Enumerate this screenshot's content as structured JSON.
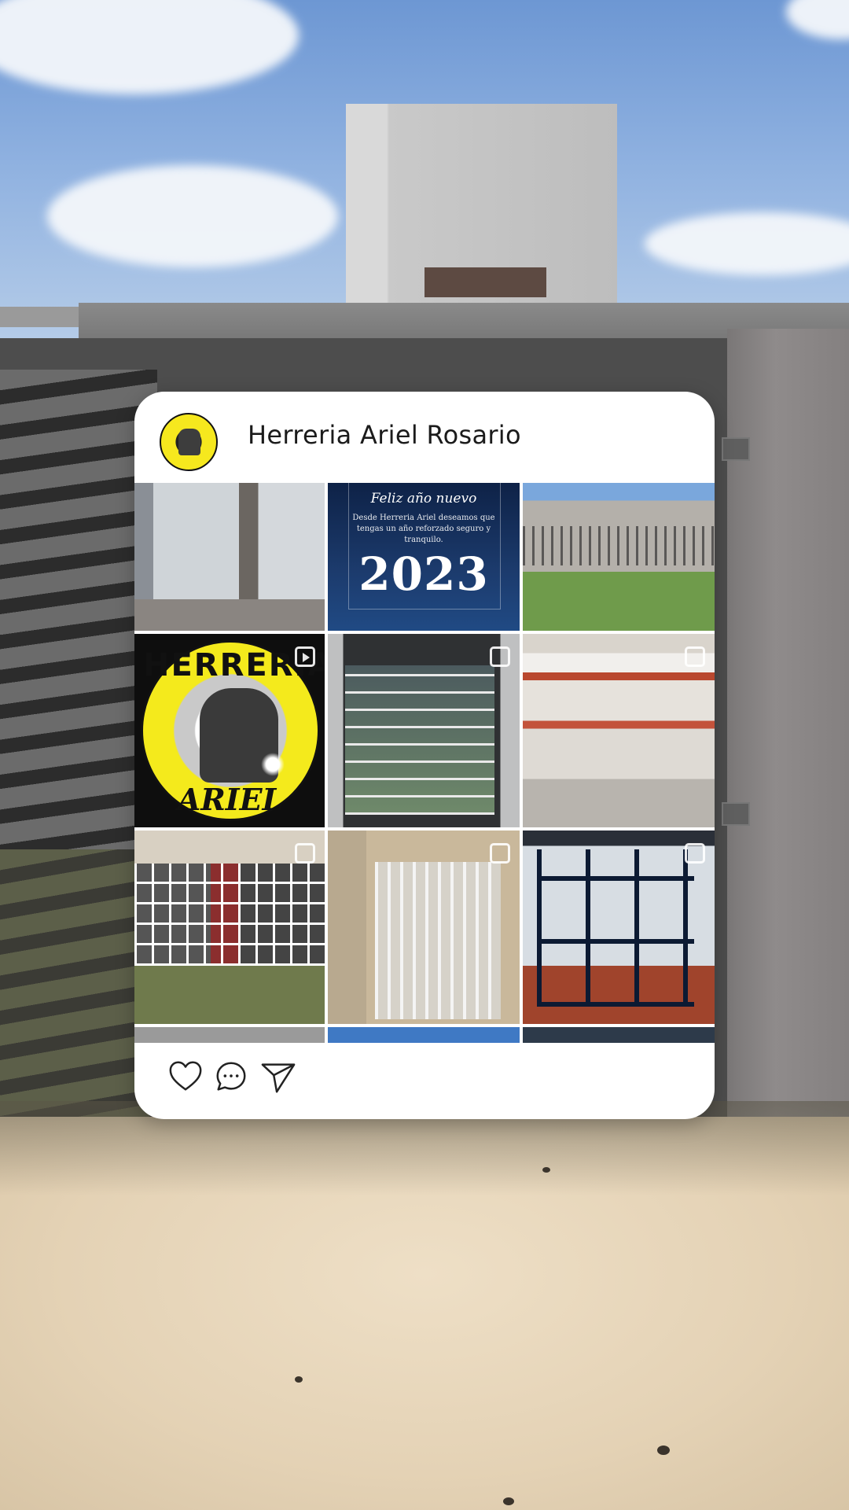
{
  "post": {
    "username": "Herreria Ariel Rosario",
    "avatar_icon": "herreria-ariel-logo",
    "grid_tiles": [
      {
        "id": "tile-1",
        "badge": null
      },
      {
        "id": "tile-2",
        "badge": null,
        "title": "Feliz año nuevo",
        "text": "Desde Herreria Ariel deseamos que tengas un año reforzado seguro y tranquilo.",
        "year": "2023"
      },
      {
        "id": "tile-3",
        "badge": null
      },
      {
        "id": "tile-4",
        "badge": "reel",
        "logo_top": "HERRERIA",
        "logo_bottom": "ARIEL"
      },
      {
        "id": "tile-5",
        "badge": "multi"
      },
      {
        "id": "tile-6",
        "badge": "multi"
      },
      {
        "id": "tile-7",
        "badge": "multi"
      },
      {
        "id": "tile-8",
        "badge": "multi"
      },
      {
        "id": "tile-9",
        "badge": "multi"
      }
    ],
    "actions": [
      "heart-icon",
      "comment-icon",
      "share-icon"
    ]
  },
  "colors": {
    "card": "#ffffff",
    "logo_yellow": "#f4ea1c",
    "icon_stroke": "#222222"
  }
}
